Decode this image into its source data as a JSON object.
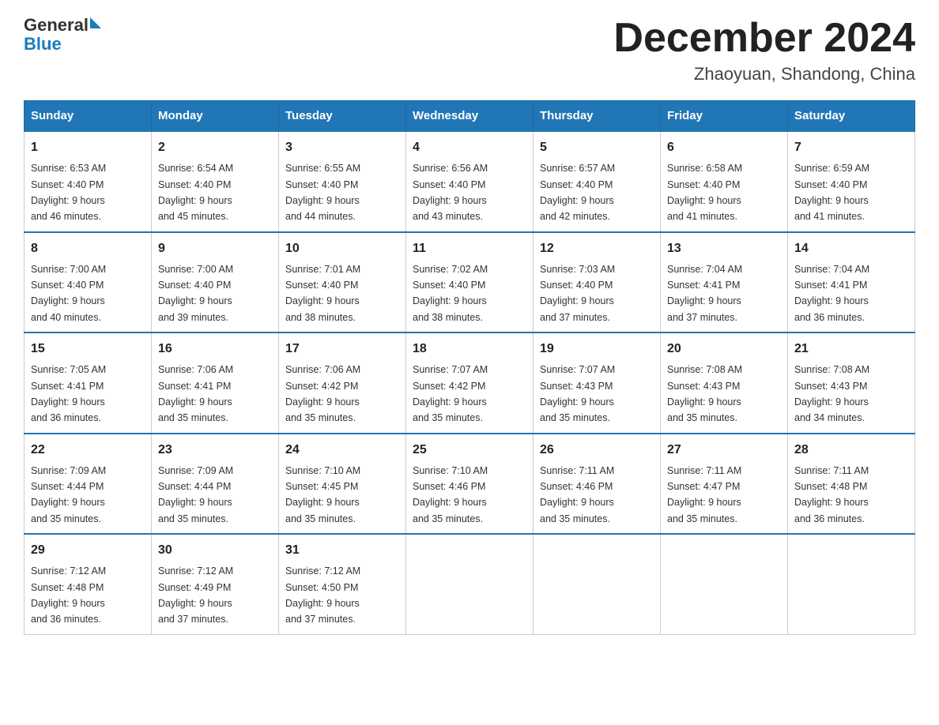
{
  "header": {
    "logo_text_general": "General",
    "logo_text_blue": "Blue",
    "month_title": "December 2024",
    "location": "Zhaoyuan, Shandong, China"
  },
  "days_of_week": [
    "Sunday",
    "Monday",
    "Tuesday",
    "Wednesday",
    "Thursday",
    "Friday",
    "Saturday"
  ],
  "weeks": [
    [
      {
        "day": "1",
        "sunrise": "6:53 AM",
        "sunset": "4:40 PM",
        "daylight": "9 hours and 46 minutes."
      },
      {
        "day": "2",
        "sunrise": "6:54 AM",
        "sunset": "4:40 PM",
        "daylight": "9 hours and 45 minutes."
      },
      {
        "day": "3",
        "sunrise": "6:55 AM",
        "sunset": "4:40 PM",
        "daylight": "9 hours and 44 minutes."
      },
      {
        "day": "4",
        "sunrise": "6:56 AM",
        "sunset": "4:40 PM",
        "daylight": "9 hours and 43 minutes."
      },
      {
        "day": "5",
        "sunrise": "6:57 AM",
        "sunset": "4:40 PM",
        "daylight": "9 hours and 42 minutes."
      },
      {
        "day": "6",
        "sunrise": "6:58 AM",
        "sunset": "4:40 PM",
        "daylight": "9 hours and 41 minutes."
      },
      {
        "day": "7",
        "sunrise": "6:59 AM",
        "sunset": "4:40 PM",
        "daylight": "9 hours and 41 minutes."
      }
    ],
    [
      {
        "day": "8",
        "sunrise": "7:00 AM",
        "sunset": "4:40 PM",
        "daylight": "9 hours and 40 minutes."
      },
      {
        "day": "9",
        "sunrise": "7:00 AM",
        "sunset": "4:40 PM",
        "daylight": "9 hours and 39 minutes."
      },
      {
        "day": "10",
        "sunrise": "7:01 AM",
        "sunset": "4:40 PM",
        "daylight": "9 hours and 38 minutes."
      },
      {
        "day": "11",
        "sunrise": "7:02 AM",
        "sunset": "4:40 PM",
        "daylight": "9 hours and 38 minutes."
      },
      {
        "day": "12",
        "sunrise": "7:03 AM",
        "sunset": "4:40 PM",
        "daylight": "9 hours and 37 minutes."
      },
      {
        "day": "13",
        "sunrise": "7:04 AM",
        "sunset": "4:41 PM",
        "daylight": "9 hours and 37 minutes."
      },
      {
        "day": "14",
        "sunrise": "7:04 AM",
        "sunset": "4:41 PM",
        "daylight": "9 hours and 36 minutes."
      }
    ],
    [
      {
        "day": "15",
        "sunrise": "7:05 AM",
        "sunset": "4:41 PM",
        "daylight": "9 hours and 36 minutes."
      },
      {
        "day": "16",
        "sunrise": "7:06 AM",
        "sunset": "4:41 PM",
        "daylight": "9 hours and 35 minutes."
      },
      {
        "day": "17",
        "sunrise": "7:06 AM",
        "sunset": "4:42 PM",
        "daylight": "9 hours and 35 minutes."
      },
      {
        "day": "18",
        "sunrise": "7:07 AM",
        "sunset": "4:42 PM",
        "daylight": "9 hours and 35 minutes."
      },
      {
        "day": "19",
        "sunrise": "7:07 AM",
        "sunset": "4:43 PM",
        "daylight": "9 hours and 35 minutes."
      },
      {
        "day": "20",
        "sunrise": "7:08 AM",
        "sunset": "4:43 PM",
        "daylight": "9 hours and 35 minutes."
      },
      {
        "day": "21",
        "sunrise": "7:08 AM",
        "sunset": "4:43 PM",
        "daylight": "9 hours and 34 minutes."
      }
    ],
    [
      {
        "day": "22",
        "sunrise": "7:09 AM",
        "sunset": "4:44 PM",
        "daylight": "9 hours and 35 minutes."
      },
      {
        "day": "23",
        "sunrise": "7:09 AM",
        "sunset": "4:44 PM",
        "daylight": "9 hours and 35 minutes."
      },
      {
        "day": "24",
        "sunrise": "7:10 AM",
        "sunset": "4:45 PM",
        "daylight": "9 hours and 35 minutes."
      },
      {
        "day": "25",
        "sunrise": "7:10 AM",
        "sunset": "4:46 PM",
        "daylight": "9 hours and 35 minutes."
      },
      {
        "day": "26",
        "sunrise": "7:11 AM",
        "sunset": "4:46 PM",
        "daylight": "9 hours and 35 minutes."
      },
      {
        "day": "27",
        "sunrise": "7:11 AM",
        "sunset": "4:47 PM",
        "daylight": "9 hours and 35 minutes."
      },
      {
        "day": "28",
        "sunrise": "7:11 AM",
        "sunset": "4:48 PM",
        "daylight": "9 hours and 36 minutes."
      }
    ],
    [
      {
        "day": "29",
        "sunrise": "7:12 AM",
        "sunset": "4:48 PM",
        "daylight": "9 hours and 36 minutes."
      },
      {
        "day": "30",
        "sunrise": "7:12 AM",
        "sunset": "4:49 PM",
        "daylight": "9 hours and 37 minutes."
      },
      {
        "day": "31",
        "sunrise": "7:12 AM",
        "sunset": "4:50 PM",
        "daylight": "9 hours and 37 minutes."
      },
      null,
      null,
      null,
      null
    ]
  ],
  "labels": {
    "sunrise": "Sunrise:",
    "sunset": "Sunset:",
    "daylight": "Daylight:"
  }
}
